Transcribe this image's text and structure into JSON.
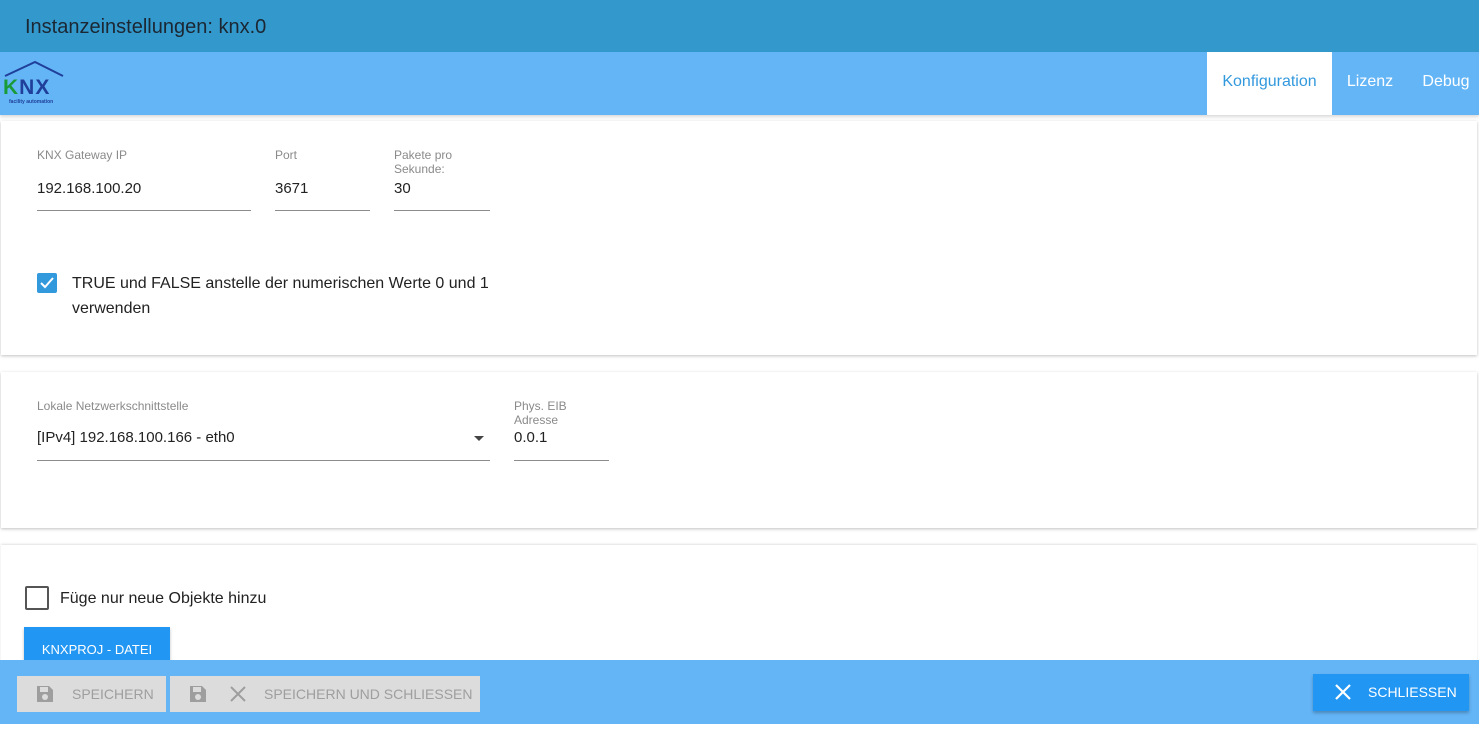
{
  "window": {
    "title": "Instanzeinstellungen: knx.0"
  },
  "logo": {
    "text_k": "K",
    "text_nx": "NX",
    "tagline": "facility automation"
  },
  "tabs": [
    {
      "label": "Konfiguration",
      "active": true
    },
    {
      "label": "Lizenz",
      "active": false
    },
    {
      "label": "Debug",
      "active": false
    }
  ],
  "connection": {
    "gateway_ip": {
      "label": "KNX Gateway IP",
      "value": "192.168.100.20"
    },
    "port": {
      "label": "Port",
      "value": "3671"
    },
    "packets": {
      "label_line1": "Pakete pro",
      "label_line2": "Sekunde:",
      "value": "30"
    },
    "bool_option": {
      "checked": true,
      "label_line1": "TRUE und FALSE anstelle der numerischen Werte 0 und 1",
      "label_line2": "verwenden"
    }
  },
  "network": {
    "interface": {
      "label": "Lokale Netzwerkschnittstelle",
      "value": "[IPv4] 192.168.100.166 - eth0"
    },
    "eib_address": {
      "label_line1": "Phys. EIB",
      "label_line2": "Adresse",
      "value": "0.0.1"
    }
  },
  "import": {
    "only_new": {
      "checked": false,
      "label": "Füge nur neue Objekte hinzu"
    },
    "file_button": "KNXPROJ - DATEI"
  },
  "footer": {
    "save": "SPEICHERN",
    "save_close": "SPEICHERN UND SCHLIESSEN",
    "close": "SCHLIESSEN"
  },
  "colors": {
    "accent": "#2196f3",
    "titlebar": "#3399cc",
    "tabbar": "#64b5f6"
  },
  "icons": [
    "save-icon",
    "close-icon",
    "check-icon",
    "dropdown-arrow-icon"
  ]
}
